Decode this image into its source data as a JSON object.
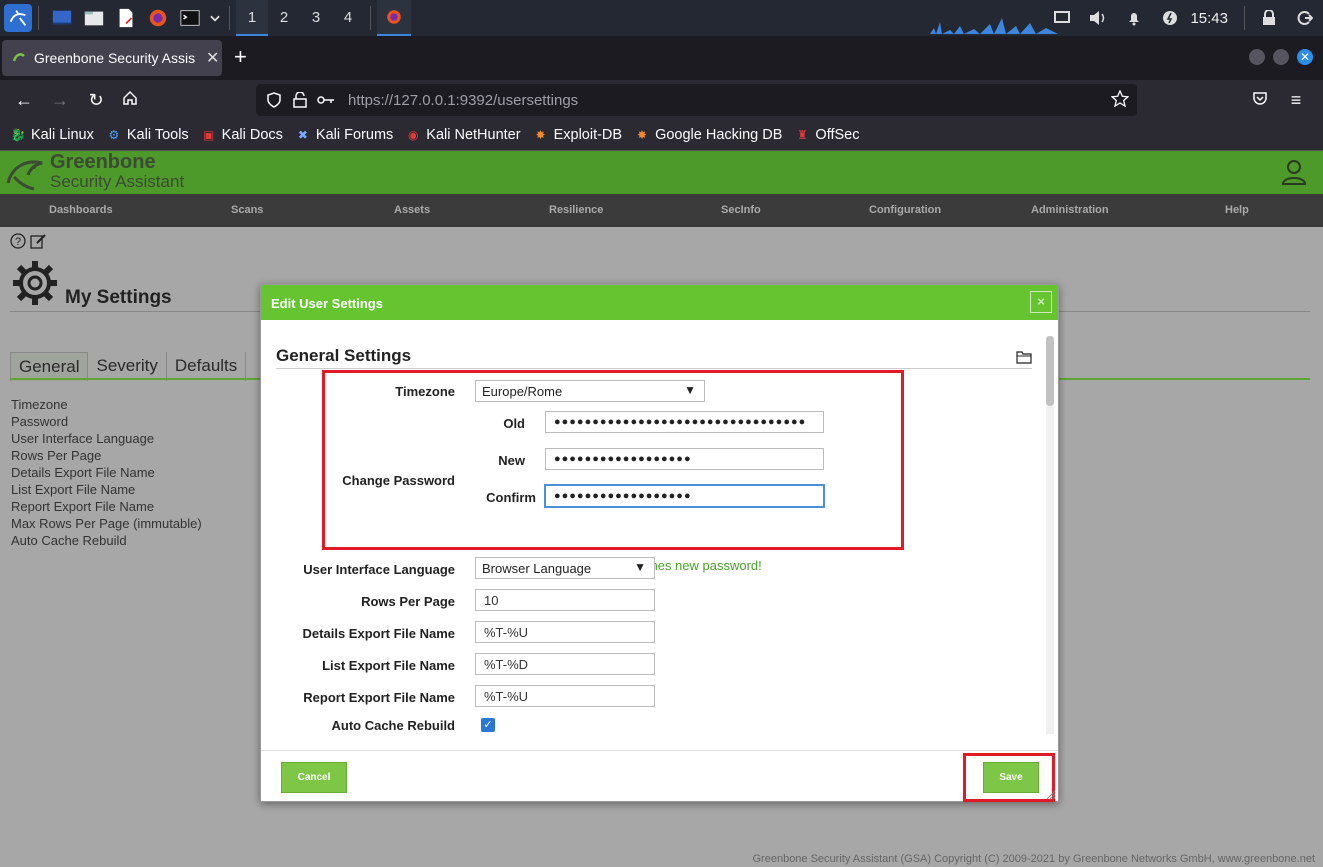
{
  "taskbar": {
    "workspaces": [
      "1",
      "2",
      "3",
      "4"
    ],
    "clock": "15:43"
  },
  "browser": {
    "tab_title": "Greenbone Security Assis",
    "url_host": "https://127.0.0.1",
    "url_path": ":9392/usersettings",
    "bookmarks": [
      "Kali Linux",
      "Kali Tools",
      "Kali Docs",
      "Kali Forums",
      "Kali NetHunter",
      "Exploit-DB",
      "Google Hacking DB",
      "OffSec"
    ]
  },
  "gsa": {
    "logo_line1": "Greenbone",
    "logo_line2": "Security Assistant",
    "menu": [
      "Dashboards",
      "Scans",
      "Assets",
      "Resilience",
      "SecInfo",
      "Configuration",
      "Administration",
      "Help"
    ],
    "page_title": "My Settings",
    "tabs": [
      "General",
      "Severity",
      "Defaults"
    ],
    "settings_list": [
      "Timezone",
      "Password",
      "User Interface Language",
      "Rows Per Page",
      "Details Export File Name",
      "List Export File Name",
      "Report Export File Name",
      "Max Rows Per Page (immutable)",
      "Auto Cache Rebuild"
    ],
    "footer": "Greenbone Security Assistant (GSA) Copyright (C) 2009-2021 by Greenbone Networks GmbH, www.greenbone.net"
  },
  "dialog": {
    "title": "Edit User Settings",
    "close": "×",
    "section_title": "General Settings",
    "timezone_label": "Timezone",
    "timezone_value": "Europe/Rome",
    "change_password_label": "Change Password",
    "old_label": "Old",
    "old_value": "●●●●●●●●●●●●●●●●●●●●●●●●●●●●●●●●●",
    "new_label": "New",
    "new_value": "●●●●●●●●●●●●●●●●●●",
    "confirm_label": "Confirm",
    "confirm_value": "●●●●●●●●●●●●●●●●●●",
    "confirm_message": "Confirmation matches new password!",
    "ui_language_label": "User Interface Language",
    "ui_language_value": "Browser Language",
    "rows_per_page_label": "Rows Per Page",
    "rows_per_page_value": "10",
    "details_export_label": "Details Export File Name",
    "details_export_value": "%T-%U",
    "list_export_label": "List Export File Name",
    "list_export_value": "%T-%D",
    "report_export_label": "Report Export File Name",
    "report_export_value": "%T-%U",
    "auto_cache_label": "Auto Cache Rebuild",
    "auto_cache_checked": true,
    "cancel_label": "Cancel",
    "save_label": "Save"
  },
  "colors": {
    "gsa_green": "#66c430",
    "header_green": "#4d9a2a",
    "highlight_red": "#e01a26",
    "focus_blue": "#4a90d9"
  }
}
